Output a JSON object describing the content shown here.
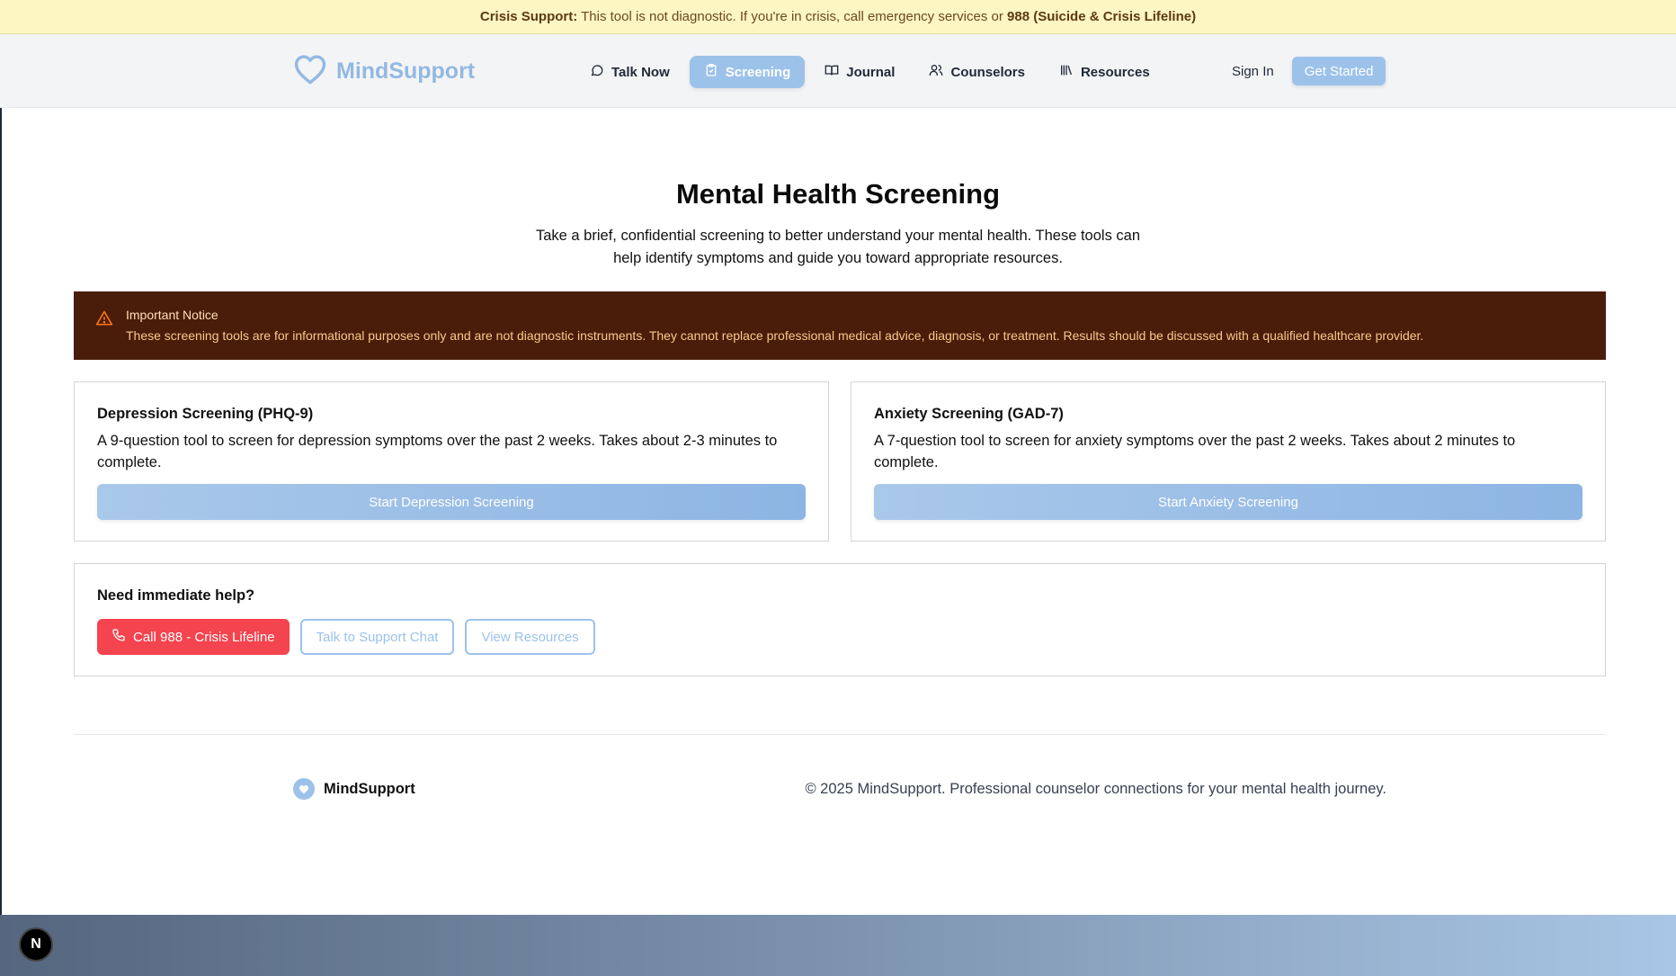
{
  "crisis_banner": {
    "label": "Crisis Support:",
    "message": " This tool is not diagnostic. If you're in crisis, call emergency services or ",
    "hotline": "988 (Suicide & Crisis Lifeline)"
  },
  "header": {
    "brand": "MindSupport",
    "nav": [
      {
        "label": "Talk Now",
        "icon": "chat-bubble-icon"
      },
      {
        "label": "Screening",
        "icon": "clipboard-icon",
        "active": true
      },
      {
        "label": "Journal",
        "icon": "book-open-icon"
      },
      {
        "label": "Counselors",
        "icon": "users-icon"
      },
      {
        "label": "Resources",
        "icon": "library-icon"
      }
    ],
    "sign_in": "Sign In",
    "get_started": "Get Started"
  },
  "hero": {
    "title": "Mental Health Screening",
    "subtitle": "Take a brief, confidential screening to better understand your mental health. These tools can help identify symptoms and guide you toward appropriate resources."
  },
  "notice": {
    "title": "Important Notice",
    "body": "These screening tools are for informational purposes only and are not diagnostic instruments. They cannot replace professional medical advice, diagnosis, or treatment. Results should be discussed with a qualified healthcare provider."
  },
  "screenings": [
    {
      "title": "Depression Screening (PHQ-9)",
      "description": "A 9-question tool to screen for depression symptoms over the past 2 weeks. Takes about 2-3 minutes to complete.",
      "button": "Start Depression Screening"
    },
    {
      "title": "Anxiety Screening (GAD-7)",
      "description": "A 7-question tool to screen for anxiety symptoms over the past 2 weeks. Takes about 2 minutes to complete.",
      "button": "Start Anxiety Screening"
    }
  ],
  "help": {
    "title": "Need immediate help?",
    "call": "Call 988 - Crisis Lifeline",
    "chat": "Talk to Support Chat",
    "resources": "View Resources"
  },
  "footer": {
    "brand": "MindSupport",
    "copyright": "© 2025 MindSupport. Professional counselor connections for your mental health journey."
  },
  "dev_badge": "N",
  "colors": {
    "accent": "#9cc2ea",
    "danger": "#f4444f",
    "notice_bg": "#4a1d0a",
    "banner_bg": "#fdf6c3"
  }
}
